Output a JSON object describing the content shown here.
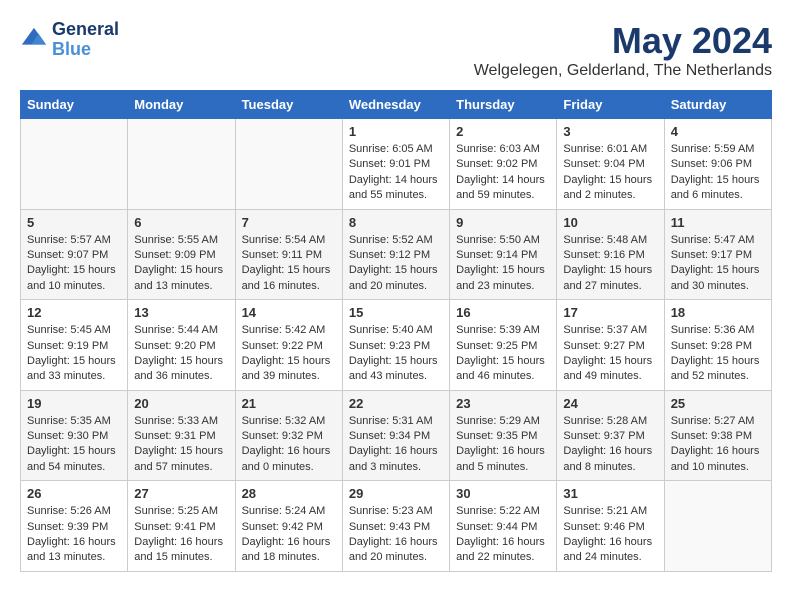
{
  "header": {
    "logo_line1": "General",
    "logo_line2": "Blue",
    "month": "May 2024",
    "location": "Welgelegen, Gelderland, The Netherlands"
  },
  "weekdays": [
    "Sunday",
    "Monday",
    "Tuesday",
    "Wednesday",
    "Thursday",
    "Friday",
    "Saturday"
  ],
  "weeks": [
    [
      {
        "day": "",
        "info": ""
      },
      {
        "day": "",
        "info": ""
      },
      {
        "day": "",
        "info": ""
      },
      {
        "day": "1",
        "info": "Sunrise: 6:05 AM\nSunset: 9:01 PM\nDaylight: 14 hours\nand 55 minutes."
      },
      {
        "day": "2",
        "info": "Sunrise: 6:03 AM\nSunset: 9:02 PM\nDaylight: 14 hours\nand 59 minutes."
      },
      {
        "day": "3",
        "info": "Sunrise: 6:01 AM\nSunset: 9:04 PM\nDaylight: 15 hours\nand 2 minutes."
      },
      {
        "day": "4",
        "info": "Sunrise: 5:59 AM\nSunset: 9:06 PM\nDaylight: 15 hours\nand 6 minutes."
      }
    ],
    [
      {
        "day": "5",
        "info": "Sunrise: 5:57 AM\nSunset: 9:07 PM\nDaylight: 15 hours\nand 10 minutes."
      },
      {
        "day": "6",
        "info": "Sunrise: 5:55 AM\nSunset: 9:09 PM\nDaylight: 15 hours\nand 13 minutes."
      },
      {
        "day": "7",
        "info": "Sunrise: 5:54 AM\nSunset: 9:11 PM\nDaylight: 15 hours\nand 16 minutes."
      },
      {
        "day": "8",
        "info": "Sunrise: 5:52 AM\nSunset: 9:12 PM\nDaylight: 15 hours\nand 20 minutes."
      },
      {
        "day": "9",
        "info": "Sunrise: 5:50 AM\nSunset: 9:14 PM\nDaylight: 15 hours\nand 23 minutes."
      },
      {
        "day": "10",
        "info": "Sunrise: 5:48 AM\nSunset: 9:16 PM\nDaylight: 15 hours\nand 27 minutes."
      },
      {
        "day": "11",
        "info": "Sunrise: 5:47 AM\nSunset: 9:17 PM\nDaylight: 15 hours\nand 30 minutes."
      }
    ],
    [
      {
        "day": "12",
        "info": "Sunrise: 5:45 AM\nSunset: 9:19 PM\nDaylight: 15 hours\nand 33 minutes."
      },
      {
        "day": "13",
        "info": "Sunrise: 5:44 AM\nSunset: 9:20 PM\nDaylight: 15 hours\nand 36 minutes."
      },
      {
        "day": "14",
        "info": "Sunrise: 5:42 AM\nSunset: 9:22 PM\nDaylight: 15 hours\nand 39 minutes."
      },
      {
        "day": "15",
        "info": "Sunrise: 5:40 AM\nSunset: 9:23 PM\nDaylight: 15 hours\nand 43 minutes."
      },
      {
        "day": "16",
        "info": "Sunrise: 5:39 AM\nSunset: 9:25 PM\nDaylight: 15 hours\nand 46 minutes."
      },
      {
        "day": "17",
        "info": "Sunrise: 5:37 AM\nSunset: 9:27 PM\nDaylight: 15 hours\nand 49 minutes."
      },
      {
        "day": "18",
        "info": "Sunrise: 5:36 AM\nSunset: 9:28 PM\nDaylight: 15 hours\nand 52 minutes."
      }
    ],
    [
      {
        "day": "19",
        "info": "Sunrise: 5:35 AM\nSunset: 9:30 PM\nDaylight: 15 hours\nand 54 minutes."
      },
      {
        "day": "20",
        "info": "Sunrise: 5:33 AM\nSunset: 9:31 PM\nDaylight: 15 hours\nand 57 minutes."
      },
      {
        "day": "21",
        "info": "Sunrise: 5:32 AM\nSunset: 9:32 PM\nDaylight: 16 hours\nand 0 minutes."
      },
      {
        "day": "22",
        "info": "Sunrise: 5:31 AM\nSunset: 9:34 PM\nDaylight: 16 hours\nand 3 minutes."
      },
      {
        "day": "23",
        "info": "Sunrise: 5:29 AM\nSunset: 9:35 PM\nDaylight: 16 hours\nand 5 minutes."
      },
      {
        "day": "24",
        "info": "Sunrise: 5:28 AM\nSunset: 9:37 PM\nDaylight: 16 hours\nand 8 minutes."
      },
      {
        "day": "25",
        "info": "Sunrise: 5:27 AM\nSunset: 9:38 PM\nDaylight: 16 hours\nand 10 minutes."
      }
    ],
    [
      {
        "day": "26",
        "info": "Sunrise: 5:26 AM\nSunset: 9:39 PM\nDaylight: 16 hours\nand 13 minutes."
      },
      {
        "day": "27",
        "info": "Sunrise: 5:25 AM\nSunset: 9:41 PM\nDaylight: 16 hours\nand 15 minutes."
      },
      {
        "day": "28",
        "info": "Sunrise: 5:24 AM\nSunset: 9:42 PM\nDaylight: 16 hours\nand 18 minutes."
      },
      {
        "day": "29",
        "info": "Sunrise: 5:23 AM\nSunset: 9:43 PM\nDaylight: 16 hours\nand 20 minutes."
      },
      {
        "day": "30",
        "info": "Sunrise: 5:22 AM\nSunset: 9:44 PM\nDaylight: 16 hours\nand 22 minutes."
      },
      {
        "day": "31",
        "info": "Sunrise: 5:21 AM\nSunset: 9:46 PM\nDaylight: 16 hours\nand 24 minutes."
      },
      {
        "day": "",
        "info": ""
      }
    ]
  ]
}
